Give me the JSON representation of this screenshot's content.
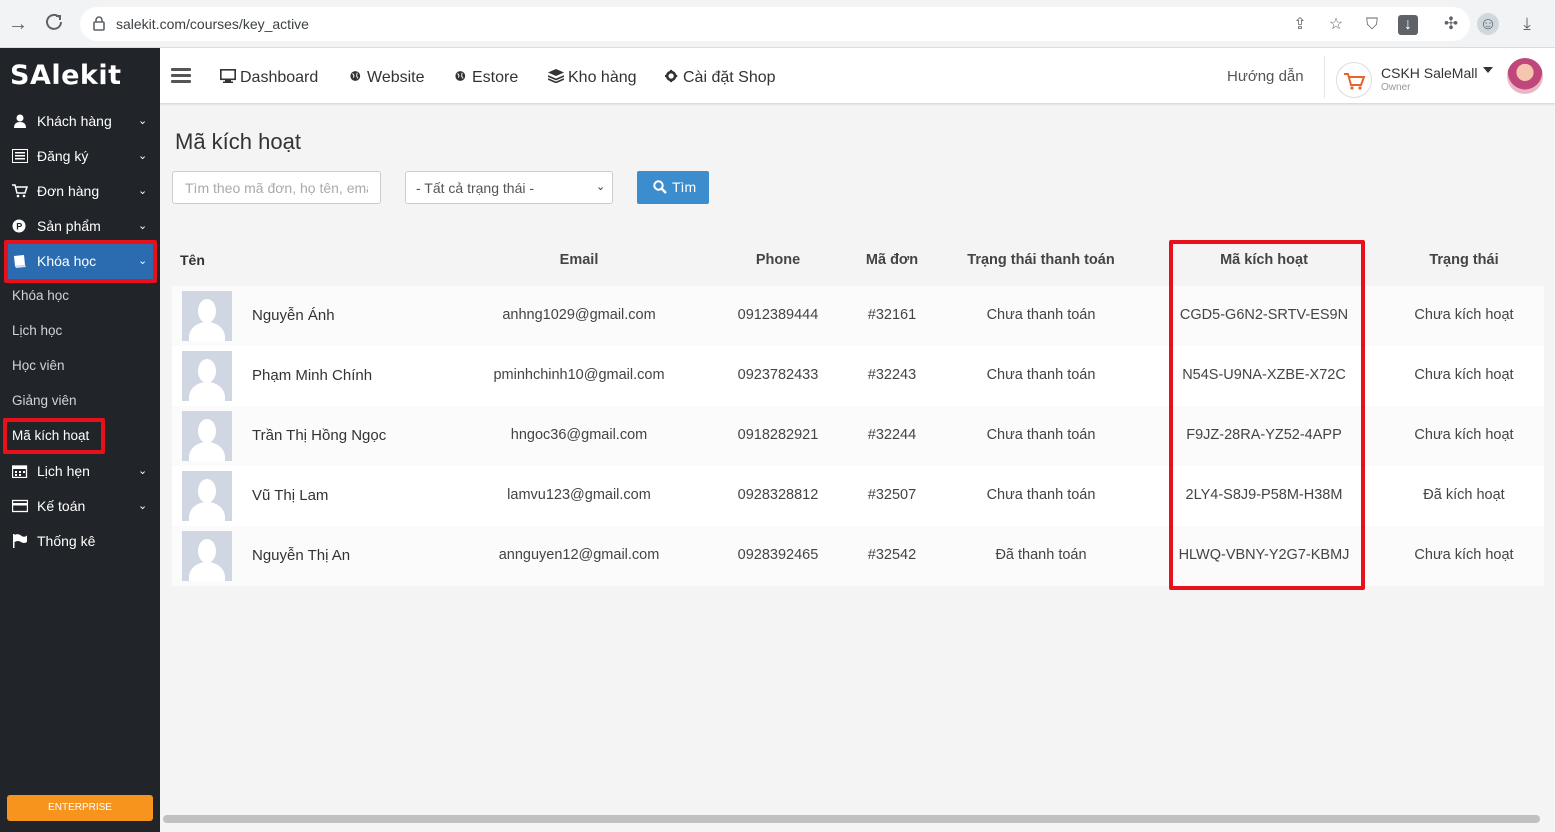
{
  "browser": {
    "url": "salekit.com/courses/key_active",
    "icons": [
      "back-icon",
      "reload-icon",
      "lock-icon",
      "share-icon",
      "star-icon",
      "shield-icon",
      "download-box-icon",
      "extensions-icon",
      "profile-icon",
      "download-icon"
    ]
  },
  "sidebar": {
    "logo": "SAlekit",
    "menu": [
      {
        "label": "Khách hàng",
        "icon": "user-icon"
      },
      {
        "label": "Đăng ký",
        "icon": "list-icon"
      },
      {
        "label": "Đơn hàng",
        "icon": "cart-icon"
      },
      {
        "label": "Sản phẩm",
        "icon": "product-icon"
      },
      {
        "label": "Khóa học",
        "icon": "book-icon"
      }
    ],
    "submenu": [
      "Khóa học",
      "Lịch học",
      "Học viên",
      "Giảng viên",
      "Mã kích hoạt"
    ],
    "menu2": [
      {
        "label": "Lịch hẹn",
        "icon": "calendar-icon"
      },
      {
        "label": "Kế toán",
        "icon": "credit-card-icon"
      },
      {
        "label": "Thống kê",
        "icon": "flag-icon"
      }
    ],
    "enterprise": "ENTERPRISE"
  },
  "topnav": {
    "links": [
      "Dashboard",
      "Website",
      "Estore",
      "Kho hàng",
      "Cài đặt Shop"
    ],
    "help": "Hướng dẫn",
    "user_name": "CSKH SaleMall",
    "user_role": "Owner"
  },
  "page": {
    "title": "Mã kích hoạt",
    "search_placeholder": "Tìm theo mã đơn, họ tên, email",
    "status_filter": "- Tất cả trạng thái -",
    "search_button": "Tìm"
  },
  "table": {
    "headers": [
      "Tên",
      "Email",
      "Phone",
      "Mã đơn",
      "Trạng thái thanh toán",
      "Mã kích hoạt",
      "Trạng thái"
    ],
    "rows": [
      {
        "name": "Nguyễn Ánh",
        "email": "anhng1029@gmail.com",
        "phone": "0912389444",
        "order": "#32161",
        "payment": "Chưa thanh toán",
        "code": "CGD5-G6N2-SRTV-ES9N",
        "status": "Chưa kích hoạt"
      },
      {
        "name": "Phạm Minh Chính",
        "email": "pminhchinh10@gmail.com",
        "phone": "0923782433",
        "order": "#32243",
        "payment": "Chưa thanh toán",
        "code": "N54S-U9NA-XZBE-X72C",
        "status": "Chưa kích hoạt"
      },
      {
        "name": "Trần Thị Hồng Ngọc",
        "email": "hngoc36@gmail.com",
        "phone": "0918282921",
        "order": "#32244",
        "payment": "Chưa thanh toán",
        "code": "F9JZ-28RA-YZ52-4APP",
        "status": "Chưa kích hoạt"
      },
      {
        "name": "Vũ Thị Lam",
        "email": "lamvu123@gmail.com",
        "phone": "0928328812",
        "order": "#32507",
        "payment": "Chưa thanh toán",
        "code": "2LY4-S8J9-P58M-H38M",
        "status": "Đã kích hoạt"
      },
      {
        "name": "Nguyễn Thị An",
        "email": "annguyen12@gmail.com",
        "phone": "0928392465",
        "order": "#32542",
        "payment": "Đã thanh toán",
        "code": "HLWQ-VBNY-Y2G7-KBMJ",
        "status": "Chưa kích hoạt"
      }
    ]
  },
  "colors": {
    "sidebar_bg": "#212529",
    "active_item": "#2b6cb0",
    "highlight": "#e8101a",
    "button": "#3c8dce",
    "enterprise": "#f7941d"
  }
}
